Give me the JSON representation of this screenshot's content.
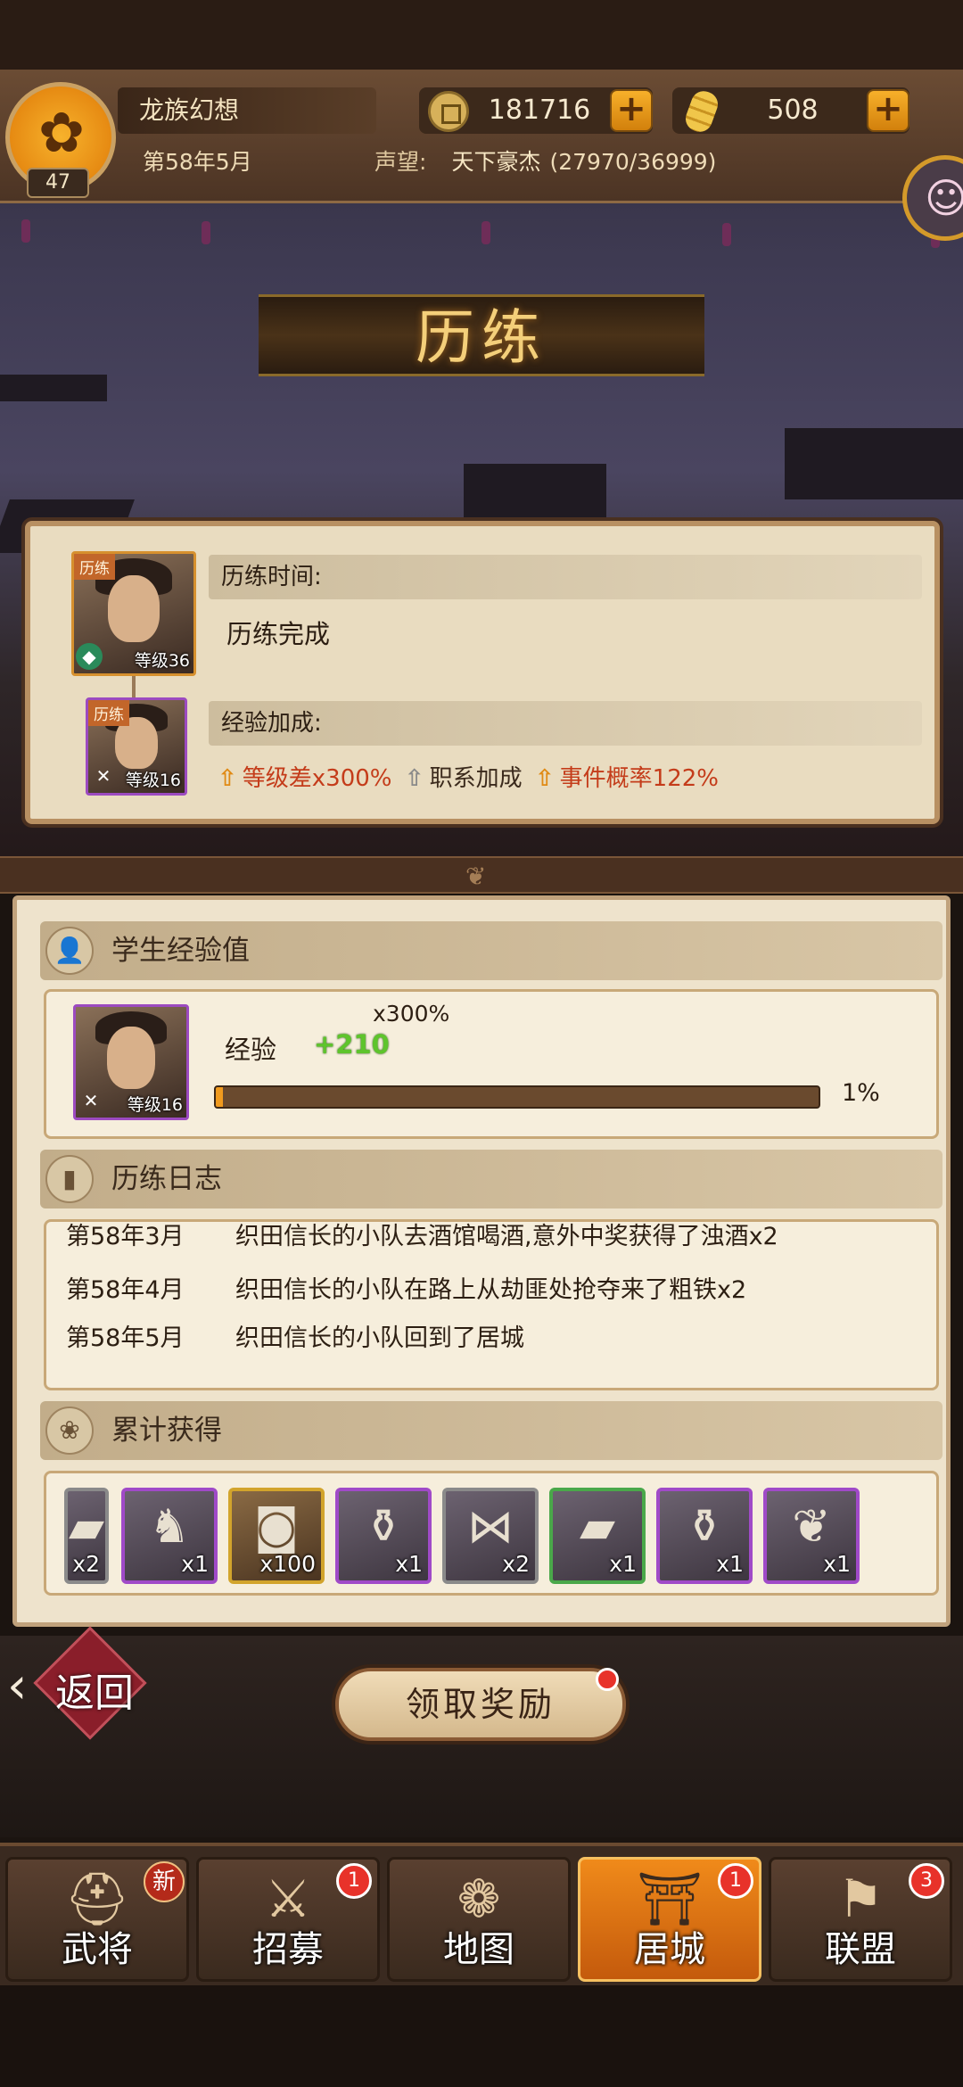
{
  "header": {
    "player_level": "47",
    "player_name": "龙族幻想",
    "date": "第58年5月",
    "copper": "181716",
    "gold": "508",
    "fame_label": "声望:",
    "fame_title": "天下豪杰",
    "fame_value": "(27970/36999)"
  },
  "page_title": "历练",
  "training": {
    "mentor_tag": "历练",
    "mentor_level": "等级36",
    "student_tag": "历练",
    "student_level": "等级16",
    "time_label": "历练时间:",
    "time_value": "历练完成",
    "bonus_label": "经验加成:",
    "bonus_level": "等级差x300%",
    "bonus_class": "职系加成",
    "bonus_event": "事件概率122%"
  },
  "student_exp": {
    "header": "学生经验值",
    "portrait_level": "等级16",
    "exp_label": "经验",
    "exp_gain": "+210",
    "multiplier": "x300%",
    "progress_pct": "1%",
    "progress_fraction": 0.01
  },
  "log": {
    "header": "历练日志",
    "entries": [
      {
        "date": "第58年3月",
        "text": "织田信长的小队去酒馆喝酒,意外中奖获得了浊酒x2"
      },
      {
        "date": "第58年4月",
        "text": "织田信长的小队在路上从劫匪处抢夺来了粗铁x2"
      },
      {
        "date": "第58年5月",
        "text": "织田信长的小队回到了居城"
      }
    ]
  },
  "rewards": {
    "header": "累计获得",
    "items": [
      {
        "icon": "iron-ingot-icon",
        "qty": "x2",
        "rarity": "grey"
      },
      {
        "icon": "horse-icon",
        "qty": "x1",
        "rarity": "purple"
      },
      {
        "icon": "coin-icon",
        "qty": "x100",
        "rarity": "gold"
      },
      {
        "icon": "sake-bottle-icon",
        "qty": "x1",
        "rarity": "purple"
      },
      {
        "icon": "fish-icon",
        "qty": "x2",
        "rarity": "grey"
      },
      {
        "icon": "steel-ingot-icon",
        "qty": "x1",
        "rarity": "green"
      },
      {
        "icon": "sake-bottle-icon",
        "qty": "x1",
        "rarity": "purple"
      },
      {
        "icon": "herb-icon",
        "qty": "x1",
        "rarity": "purple"
      }
    ]
  },
  "actions": {
    "back": "返回",
    "claim": "领取奖励"
  },
  "nav": [
    {
      "label": "武将",
      "badge": "新"
    },
    {
      "label": "招募",
      "badge": "1"
    },
    {
      "label": "地图",
      "badge": ""
    },
    {
      "label": "居城",
      "badge": "1"
    },
    {
      "label": "联盟",
      "badge": "3"
    }
  ],
  "colors": {
    "accent_orange": "#f08a1a",
    "bonus_red": "#c43c1a",
    "exp_green": "#5ec42c",
    "badge_red": "#e8322a"
  }
}
